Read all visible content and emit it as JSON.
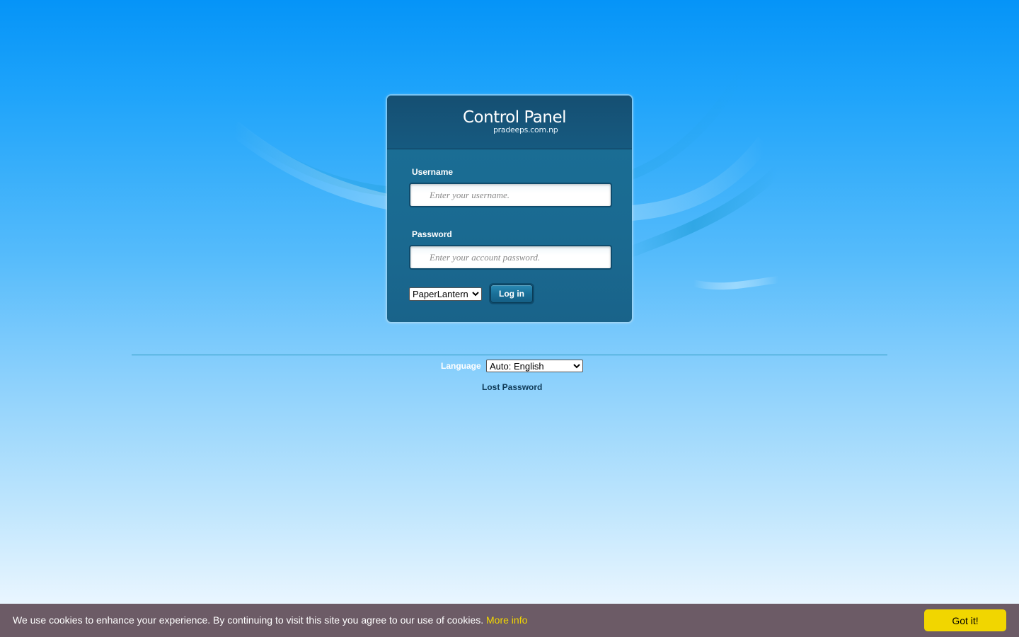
{
  "panel": {
    "logo_title": "Control Panel",
    "logo_subtitle": "pradeeps.com.np"
  },
  "username": {
    "label": "Username",
    "placeholder": "Enter your username.",
    "value": ""
  },
  "password": {
    "label": "Password",
    "placeholder": "Enter your account password.",
    "value": ""
  },
  "theme_select": {
    "selected": "PaperLantern",
    "options": [
      "PaperLantern"
    ]
  },
  "login_button": {
    "label": "Log in"
  },
  "language": {
    "label": "Language",
    "selected": "Auto: English",
    "options": [
      "Auto: English"
    ]
  },
  "lost_password": {
    "label": "Lost Password"
  },
  "cookie_bar": {
    "message": "We use cookies to enhance your experience. By continuing to visit this site you agree to our use of cookies.",
    "more_info": "More info",
    "accept_label": "Got it!"
  },
  "colors": {
    "panel_bg": "#1a6a91",
    "header_bg": "#154f72",
    "cookie_bg": "#6c5b66",
    "cookie_accent": "#f1d600",
    "lost_password_text": "#0f3a57"
  }
}
